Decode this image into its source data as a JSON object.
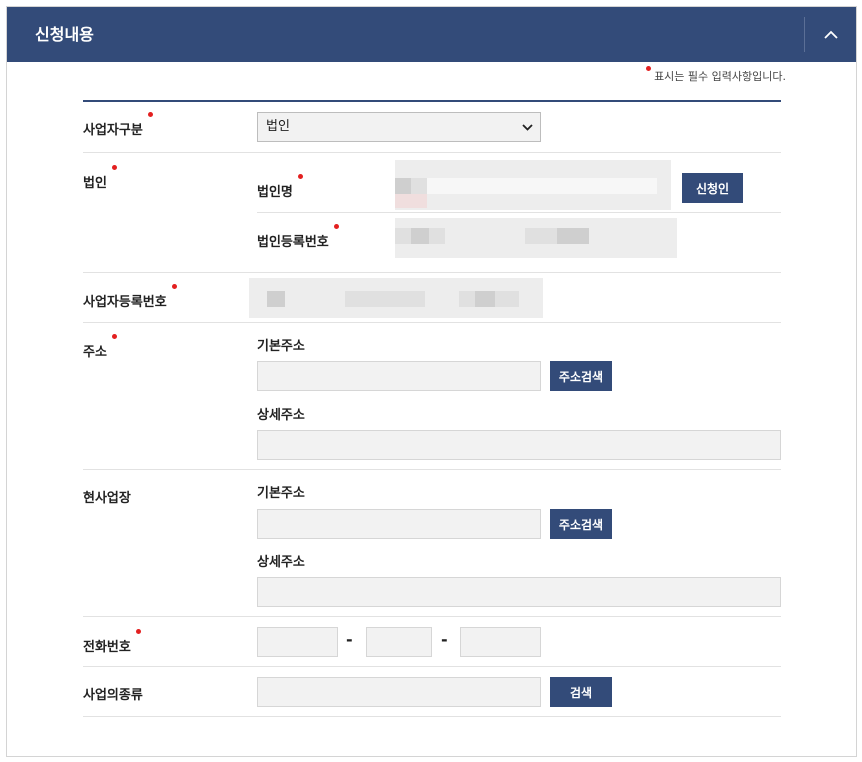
{
  "panel": {
    "title": "신청내용",
    "collapse_icon": "chevron-up-icon"
  },
  "notice": {
    "text": "표시는 필수 입력사항입니다."
  },
  "fields": {
    "business_type": {
      "label": "사업자구분",
      "value": "법인",
      "options": [
        "법인"
      ]
    },
    "corporation": {
      "label": "법인",
      "name_label": "법인명",
      "applicant_button": "신청인",
      "reg_no_label": "법인등록번호"
    },
    "business_reg_no": {
      "label": "사업자등록번호"
    },
    "address": {
      "label": "주소",
      "basic_label": "기본주소",
      "search_button": "주소검색",
      "detail_label": "상세주소"
    },
    "site": {
      "label": "현사업장",
      "basic_label": "기본주소",
      "search_button": "주소검색",
      "detail_label": "상세주소"
    },
    "phone": {
      "label": "전화번호",
      "separator": "-"
    },
    "business_kind": {
      "label": "사업의종류",
      "search_button": "검색"
    }
  },
  "colors": {
    "header_bg": "#334b79",
    "button_bg": "#334b79",
    "required_dot": "#e32020",
    "input_bg": "#f2f2f2"
  }
}
